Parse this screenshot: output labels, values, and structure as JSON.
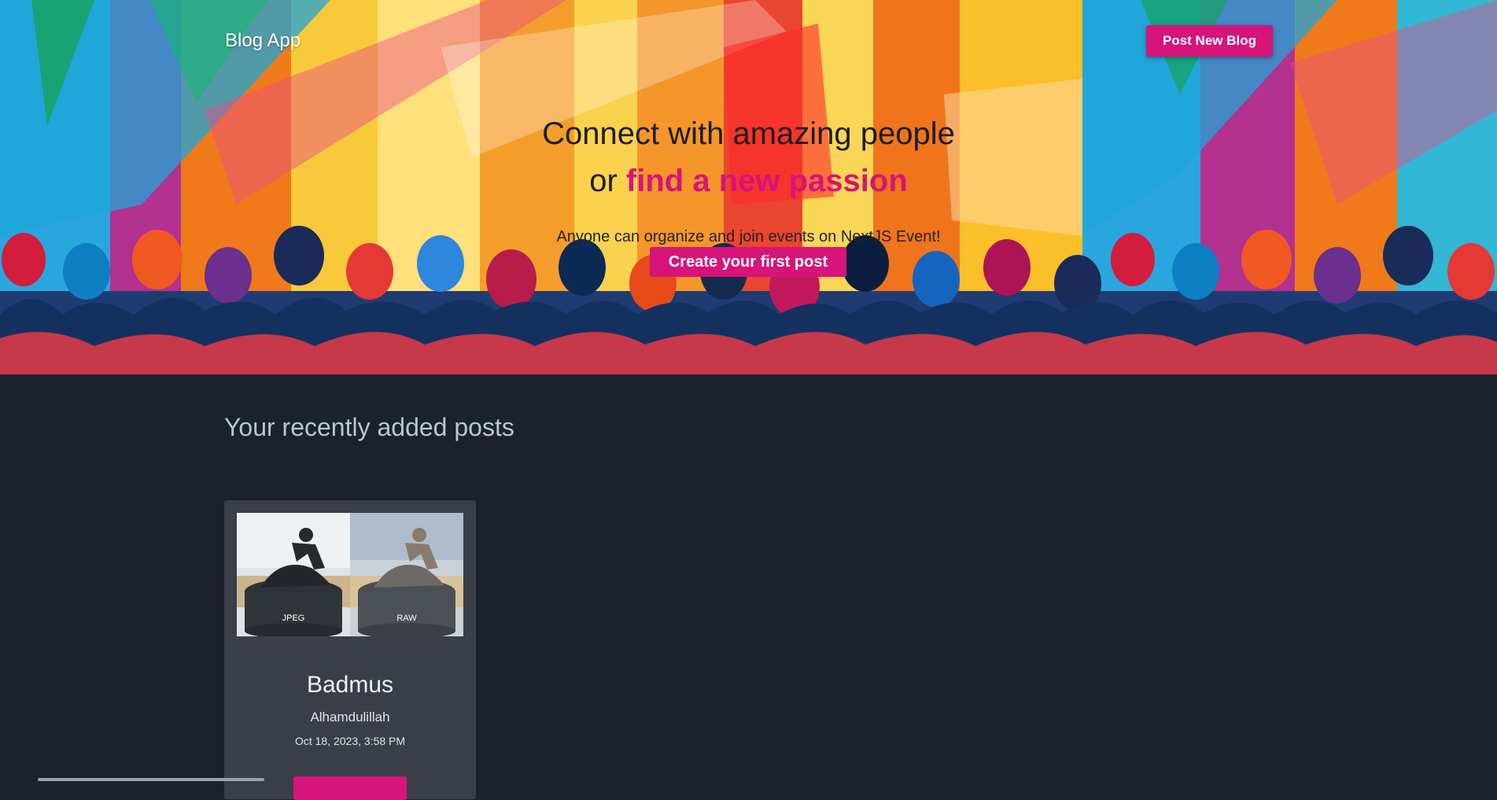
{
  "nav": {
    "brand": "Blog App",
    "post_new_label": "Post New Blog"
  },
  "hero": {
    "headline_line1": "Connect with amazing people",
    "headline_prefix": "or ",
    "headline_accent": "find a new passion",
    "subline": "Anyone can organize and join events on NextJS Event!",
    "cta_label": "Create your first post"
  },
  "recent": {
    "title": "Your recently added posts",
    "posts": [
      {
        "image_labels": [
          "JPEG",
          "RAW"
        ],
        "title": "Badmus",
        "description": "Alhamdulillah",
        "date": "Oct 18, 2023, 3:58 PM"
      }
    ]
  },
  "colors": {
    "accent": "#d6147a",
    "page_bg": "#1b222d",
    "card_bg": "#3a3e46",
    "section_title": "#b8c6d6"
  }
}
